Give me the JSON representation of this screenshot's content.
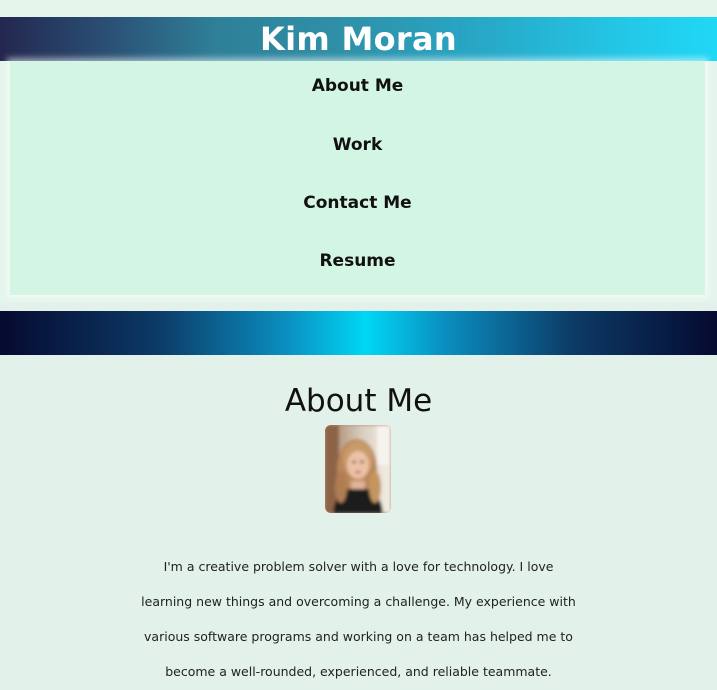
{
  "header": {
    "name": "Kim Moran"
  },
  "nav": {
    "items": [
      {
        "label": "About Me"
      },
      {
        "label": "Work"
      },
      {
        "label": "Contact Me"
      },
      {
        "label": "Resume"
      }
    ]
  },
  "colors": {
    "page_background": "#e2f1ea",
    "nav_background": "#d2f6e3",
    "banner_gradient_start": "#24274f",
    "banner_gradient_end": "#1fd8f6",
    "divider_center": "#00d7f5",
    "divider_edges": "#050a30"
  },
  "about": {
    "title": "About Me",
    "photo": "profile-photo",
    "bio_lines": [
      "I'm a creative problem solver with a love for technology. I love",
      "learning new things and overcoming a challenge. My experience with",
      "various software programs and working on a team has helped me to",
      "become a well-rounded, experienced, and reliable teammate."
    ]
  }
}
